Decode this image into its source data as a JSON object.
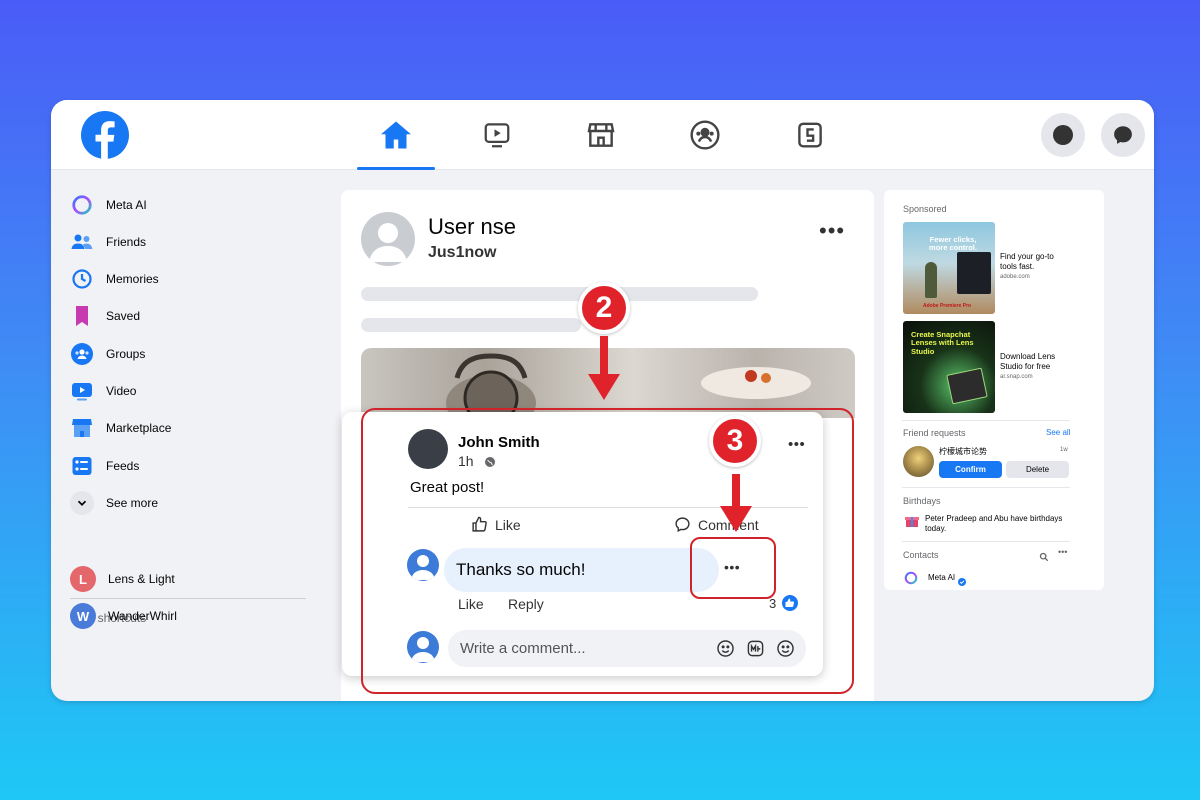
{
  "nav": {
    "tabs": [
      "home",
      "video",
      "marketplace",
      "groups",
      "gaming"
    ],
    "active": "home"
  },
  "sidebar": {
    "items": [
      {
        "label": "Meta AI",
        "icon": "meta-ai-icon"
      },
      {
        "label": "Friends",
        "icon": "friends-icon"
      },
      {
        "label": "Memories",
        "icon": "memories-icon"
      },
      {
        "label": "Saved",
        "icon": "saved-icon"
      },
      {
        "label": "Groups",
        "icon": "groups-icon"
      },
      {
        "label": "Video",
        "icon": "video-icon"
      },
      {
        "label": "Marketplace",
        "icon": "marketplace-icon"
      },
      {
        "label": "Feeds",
        "icon": "feeds-icon"
      },
      {
        "label": "See more",
        "icon": "chevron-down-icon"
      }
    ],
    "shortcuts_heading": "Your shortcuts",
    "shortcuts": [
      {
        "label": "Lens & Light",
        "initial": "L",
        "color": "#e4676b"
      },
      {
        "label": "WanderWhirl",
        "initial": "W",
        "color": "#4b7bd8"
      }
    ]
  },
  "post": {
    "author": "User nse",
    "time": "Jus1now"
  },
  "comment_dialog": {
    "author": "John Smith",
    "time": "1h",
    "text": "Great post!",
    "like_label": "Like",
    "comment_label": "Comment",
    "reply": {
      "text": "Thanks so much!",
      "like": "Like",
      "reply": "Reply",
      "reaction_count": "3"
    },
    "input_placeholder": "Write a comment..."
  },
  "annotations": {
    "step_a": "2",
    "step_b": "3",
    "accent": "#e0222b"
  },
  "right": {
    "sponsored": "Sponsored",
    "ads": [
      {
        "title": "Find your go-to tools fast.",
        "domain": "adobe.com",
        "img_text": "Fewer clicks, more control.",
        "brand": "Adobe Premiere Pro"
      },
      {
        "title": "Download Lens Studio for free",
        "domain": "ar.snap.com",
        "img_text": "Create Snapchat Lenses with Lens Studio"
      }
    ],
    "friend_requests": "Friend requests",
    "see_all": "See all",
    "request_name": "柠檬城市论势",
    "request_time": "1w",
    "confirm": "Confirm",
    "delete": "Delete",
    "birthdays": "Birthdays",
    "birthday_text": "Peter Pradeep and Abu have birthdays today.",
    "contacts": "Contacts",
    "contact_name": "Meta AI"
  },
  "colors": {
    "brand": "#1877f2",
    "page_bg": "#f0f2f5"
  }
}
